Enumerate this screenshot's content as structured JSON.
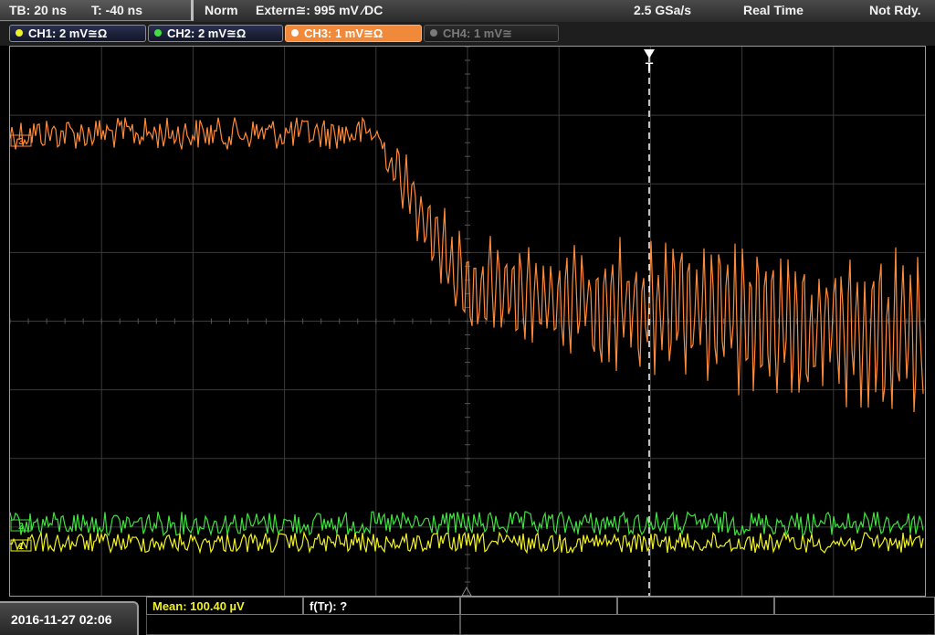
{
  "topbar": {
    "timebase": "TB: 20 ns",
    "trigger_time": "T: -40 ns",
    "mode": "Norm",
    "trigger_source": "Extern≅: 995 mV ∕DC",
    "sample_rate": "2.5 GSa/s",
    "acq_mode": "Real Time",
    "status": "Not Rdy."
  },
  "channels": [
    {
      "label": "CH1: 2 mV≅Ω",
      "color": "#f0f028",
      "state": "on"
    },
    {
      "label": "CH2: 2 mV≅Ω",
      "color": "#40e040",
      "state": "on"
    },
    {
      "label": "CH3: 1 mV≅Ω",
      "color": "#ff8a3c",
      "state": "active"
    },
    {
      "label": "CH4: 1 mV≅",
      "color": "#7a7a7a",
      "state": "off"
    }
  ],
  "measurements": {
    "mean": "Mean: 100.40 µV",
    "rise_freq": "f(Tr): ?"
  },
  "datetime": "2016-11-27 02:06",
  "markers": {
    "trigger_label": "T",
    "ch3_marker": "3",
    "ch1_marker": "1",
    "ch2_marker": "2"
  },
  "colors": {
    "ch1": "#f0f028",
    "ch2": "#40e040",
    "ch3": "#ff8a3c",
    "grid": "#3a3a3a",
    "measure_text": "#f0f028"
  }
}
